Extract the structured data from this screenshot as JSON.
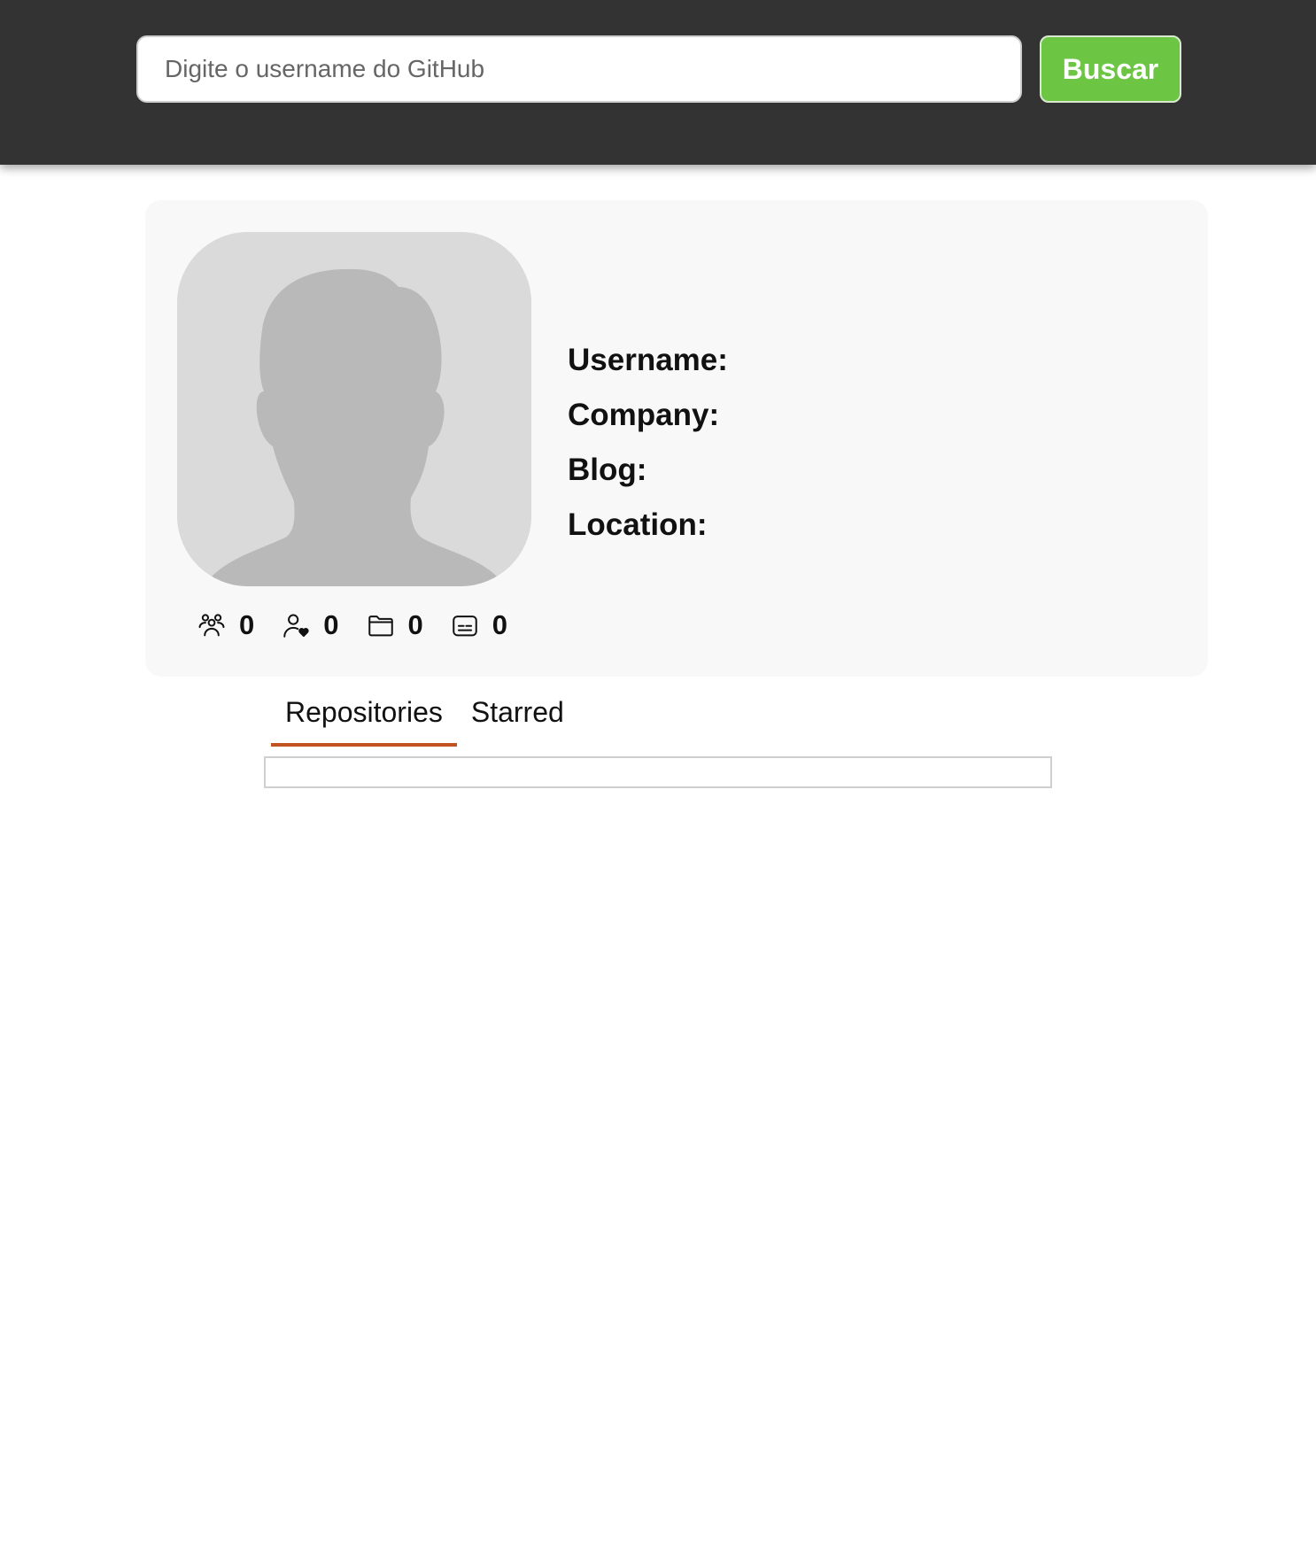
{
  "search": {
    "placeholder": "Digite o username do GitHub",
    "value": "",
    "button_label": "Buscar"
  },
  "profile": {
    "avatar": "default-avatar-silhouette",
    "fields": [
      {
        "label": "Username:",
        "value": ""
      },
      {
        "label": "Company:",
        "value": ""
      },
      {
        "label": "Blog:",
        "value": ""
      },
      {
        "label": "Location:",
        "value": ""
      }
    ],
    "stats": [
      {
        "icon": "followers-icon",
        "count": "0"
      },
      {
        "icon": "following-icon",
        "count": "0"
      },
      {
        "icon": "folder-icon",
        "count": "0"
      },
      {
        "icon": "gists-icon",
        "count": "0"
      }
    ]
  },
  "tabs": [
    {
      "label": "Repositories",
      "active": true
    },
    {
      "label": "Starred",
      "active": false
    }
  ],
  "colors": {
    "header_bg": "#333333",
    "button_bg": "#6cc644",
    "card_bg": "#f8f8f8",
    "tab_active_underline": "#c0531f"
  }
}
